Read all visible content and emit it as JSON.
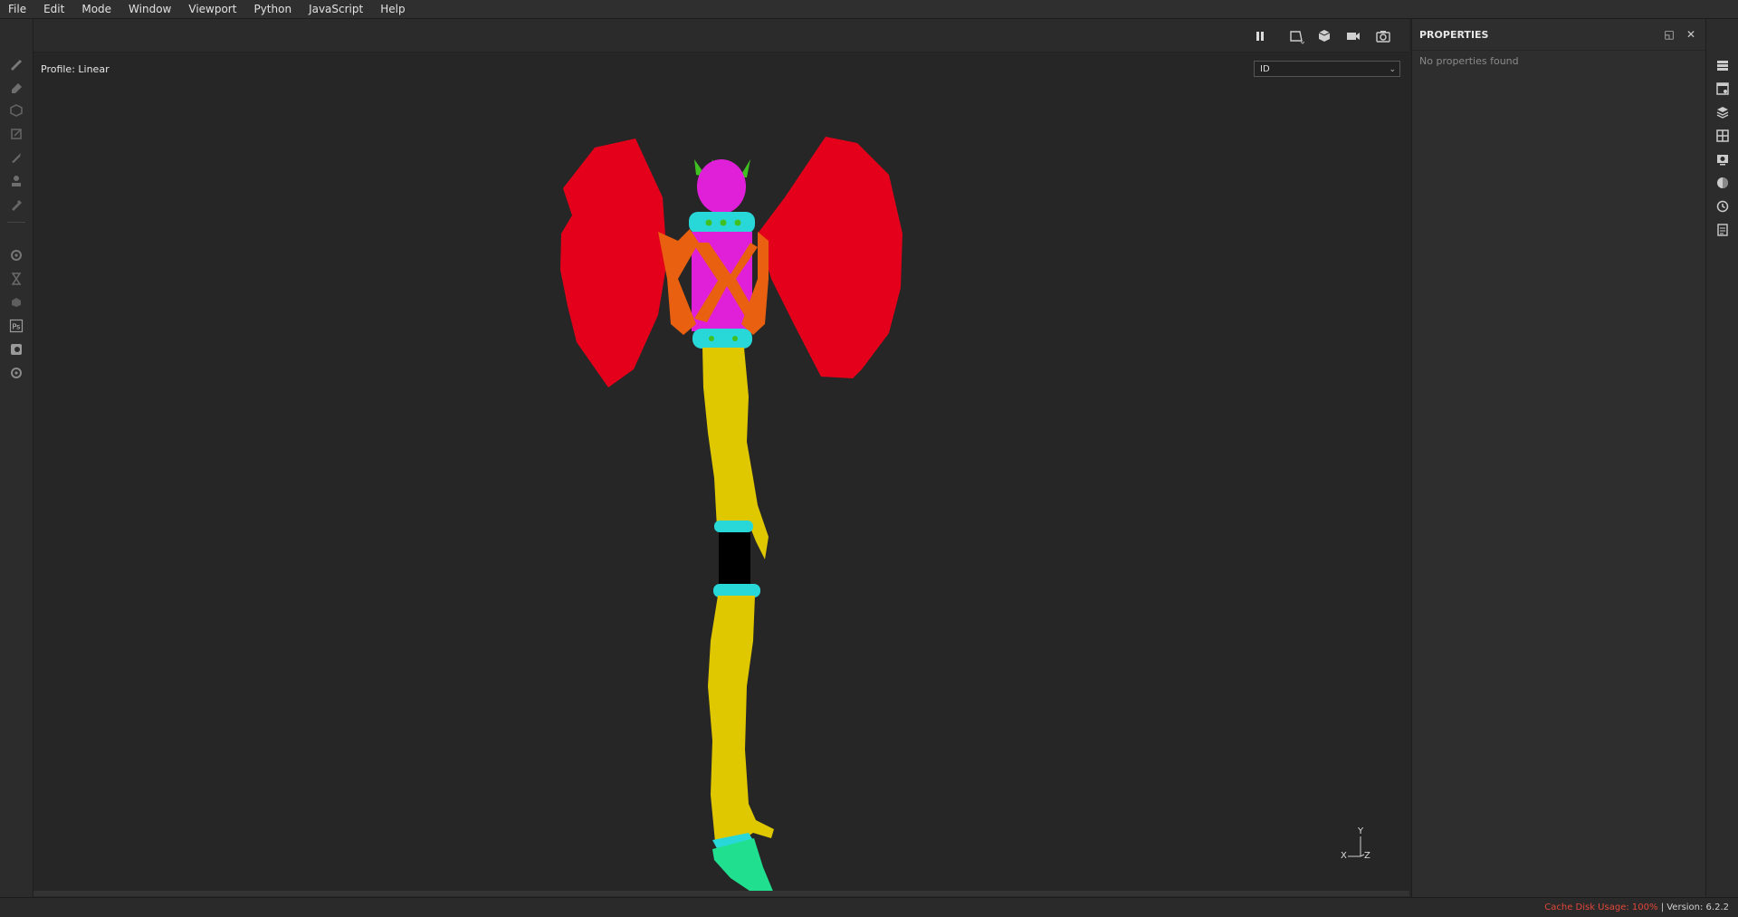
{
  "menubar": {
    "items": [
      "File",
      "Edit",
      "Mode",
      "Window",
      "Viewport",
      "Python",
      "JavaScript",
      "Help"
    ]
  },
  "left_toolbar": {
    "tools": [
      "paint-brush-icon",
      "eraser-icon",
      "projection-icon",
      "polygon-fill-icon",
      "smudge-icon",
      "clone-stamp-icon",
      "color-picker-icon",
      "bake-settings-icon",
      "iray-icon",
      "sparse-icon",
      "photoshop-icon",
      "export-icon",
      "plugins-icon"
    ]
  },
  "viewport": {
    "profile_label": "Profile: Linear",
    "display_channel": "ID",
    "axis": {
      "y": "Y",
      "x": "X",
      "z": "Z"
    },
    "colors": {
      "blade": "#e4001a",
      "handle": "#e0c800",
      "pommel_cap": "#e020d8",
      "rings": "#28d8d8",
      "bindings": "#e86010",
      "horns": "#40c020",
      "grip": "#000000",
      "spike": "#20e090"
    }
  },
  "viewport_toolbar": {
    "buttons": [
      "pause-icon",
      "2d-view-icon",
      "3d-view-icon",
      "camera-icon",
      "screenshot-icon"
    ]
  },
  "properties": {
    "title": "PROPERTIES",
    "empty_text": "No properties found"
  },
  "right_toolbar": {
    "buttons": [
      "texture-set-list-icon",
      "texture-set-settings-icon",
      "layers-icon",
      "shelf-icon",
      "display-settings-icon",
      "shader-settings-icon",
      "history-icon",
      "log-icon"
    ]
  },
  "statusbar": {
    "cache_label": "Cache Disk Usage:",
    "cache_value": "100%",
    "version": "| Version: 6.2.2"
  }
}
